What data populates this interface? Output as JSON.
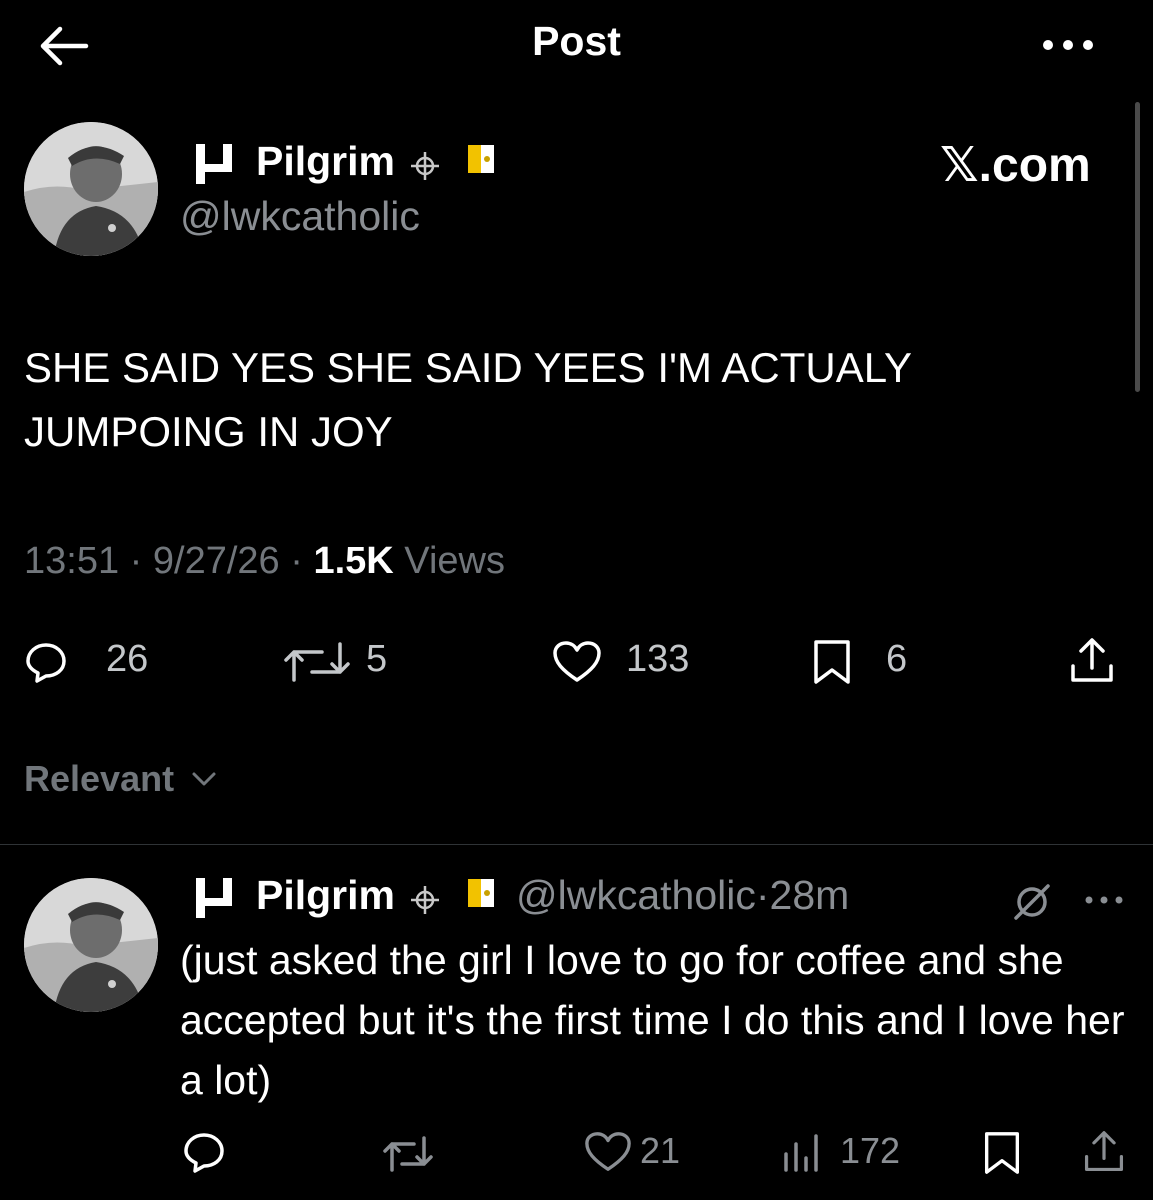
{
  "header": {
    "title": "Post"
  },
  "main_post": {
    "author_name": "Pilgrim",
    "author_handle": "@lwkcatholic",
    "watermark": "𝕏.com",
    "text": "SHE SAID YES SHE SAID YEES I'M ACTUALY JUMPOING IN JOY",
    "time": "13:51",
    "date": "9/27/26",
    "views_count": "1.5K",
    "views_label": "Views",
    "replies": "26",
    "reposts": "5",
    "likes": "133",
    "bookmarks": "6"
  },
  "sort": {
    "label": "Relevant"
  },
  "reply_post": {
    "author_name": "Pilgrim",
    "author_handle": "@lwkcatholic",
    "age": "28m",
    "text": "(just asked the girl I love to go for coffee and she accepted but it's the first time I do this and I love her a lot)",
    "likes": "21",
    "views": "172"
  },
  "icons": {
    "back": "arrow-left-icon",
    "more": "more-horizontal-icon",
    "brand": "brand-glyph-icon",
    "cross": "crosshair-icon",
    "flag": "vatican-flag-icon",
    "reply": "reply-bubble-icon",
    "repost": "repost-icon",
    "like": "heart-icon",
    "bookmark": "bookmark-icon",
    "share": "share-icon",
    "views": "views-bars-icon",
    "grok": "grok-icon",
    "chevron": "chevron-down-icon"
  },
  "colors": {
    "background": "#000000",
    "primary_text": "#ffffff",
    "secondary_text": "#71767b",
    "divider": "#2f3336",
    "flag_yellow": "#f2c200",
    "flag_white": "#ffffff"
  }
}
